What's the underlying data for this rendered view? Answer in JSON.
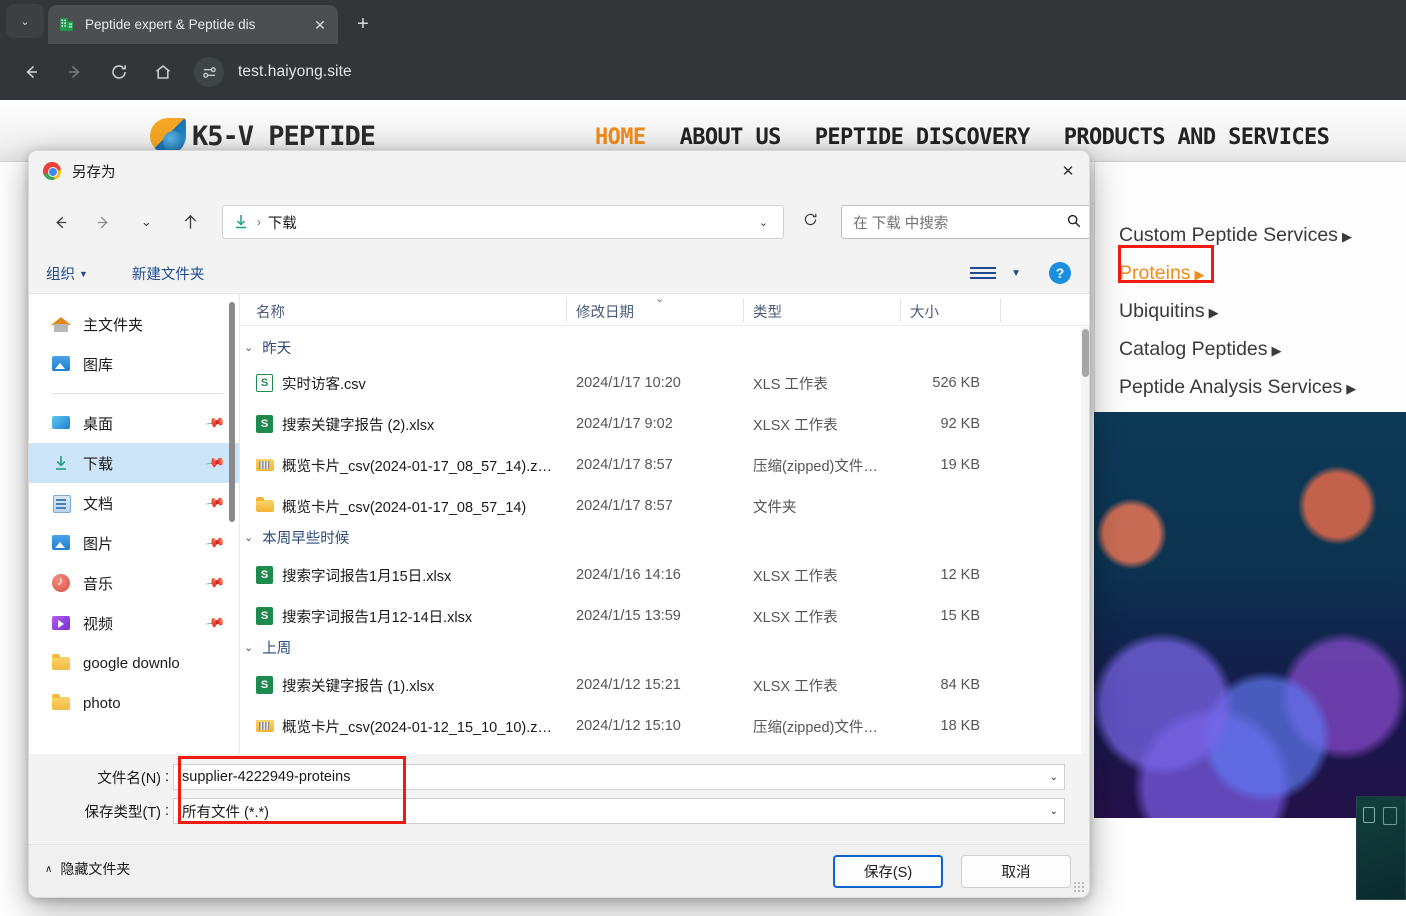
{
  "browser": {
    "tab": {
      "title": "Peptide expert & Peptide dis",
      "favicon": "building-icon",
      "close": "✕"
    },
    "new_tab": "+",
    "tab_list": "⌄",
    "nav": {
      "back": "←",
      "forward": "→",
      "reload": "⟳",
      "home": "⌂"
    },
    "url": "test.haiyong.site"
  },
  "website": {
    "logo_text": "K5-V PEPTIDE",
    "nav": [
      {
        "label": "HOME",
        "active": true
      },
      {
        "label": "ABOUT US",
        "active": false
      },
      {
        "label": "PEPTIDE DISCOVERY",
        "active": false
      },
      {
        "label": "PRODUCTS AND SERVICES",
        "active": false
      }
    ],
    "dropdown": [
      {
        "label": "Custom Peptide Services",
        "caret": "▶",
        "highlight": false
      },
      {
        "label": "Proteins",
        "caret": "▶",
        "highlight": true
      },
      {
        "label": "Ubiquitins",
        "caret": "▶",
        "highlight": false
      },
      {
        "label": "Catalog Peptides",
        "caret": "▶",
        "highlight": false
      },
      {
        "label": "Peptide Analysis Services",
        "caret": "▶",
        "highlight": false
      }
    ],
    "accent_color": "#ef8c1c"
  },
  "dialog": {
    "title": "另存为",
    "close": "✕",
    "nav": {
      "back": "←",
      "forward": "→",
      "recent": "⌄",
      "up": "↑",
      "refresh": "⟳"
    },
    "address": {
      "icon": "download-icon",
      "separator": "›",
      "path": "下载",
      "chevron": "⌄"
    },
    "search": {
      "placeholder": "在 下载 中搜索",
      "icon": "search-icon"
    },
    "commands": {
      "organize": "组织",
      "organize_caret": "▼",
      "new_folder": "新建文件夹",
      "view_caret": "▼",
      "help": "?"
    },
    "sidebar": [
      {
        "label": "主文件夹",
        "icon": "home-icon",
        "pinned": false,
        "selected": false
      },
      {
        "label": "图库",
        "icon": "gallery-icon",
        "pinned": false,
        "selected": false
      },
      {
        "label": "桌面",
        "icon": "desktop-icon",
        "pinned": true,
        "selected": false
      },
      {
        "label": "下载",
        "icon": "download-icon",
        "pinned": true,
        "selected": true
      },
      {
        "label": "文档",
        "icon": "documents-icon",
        "pinned": true,
        "selected": false
      },
      {
        "label": "图片",
        "icon": "pictures-icon",
        "pinned": true,
        "selected": false
      },
      {
        "label": "音乐",
        "icon": "music-icon",
        "pinned": true,
        "selected": false
      },
      {
        "label": "视频",
        "icon": "video-icon",
        "pinned": true,
        "selected": false
      },
      {
        "label": "google downlo",
        "icon": "folder-icon",
        "pinned": false,
        "selected": false
      },
      {
        "label": "photo",
        "icon": "folder-icon",
        "pinned": false,
        "selected": false
      }
    ],
    "columns": [
      "名称",
      "修改日期",
      "类型",
      "大小"
    ],
    "sort_caret": "⌄",
    "groups": [
      {
        "label": "昨天",
        "caret": "⌄",
        "files": [
          {
            "name": "实时访客.csv",
            "date": "2024/1/17 10:20",
            "type": "XLS 工作表",
            "size": "526 KB",
            "icon": "xls-icon"
          },
          {
            "name": "搜索关键字报告 (2).xlsx",
            "date": "2024/1/17 9:02",
            "type": "XLSX 工作表",
            "size": "92 KB",
            "icon": "xlsx-icon"
          },
          {
            "name": "概览卡片_csv(2024-01-17_08_57_14).z…",
            "date": "2024/1/17 8:57",
            "type": "压缩(zipped)文件…",
            "size": "19 KB",
            "icon": "zip-icon"
          },
          {
            "name": "概览卡片_csv(2024-01-17_08_57_14)",
            "date": "2024/1/17 8:57",
            "type": "文件夹",
            "size": "",
            "icon": "folder-icon"
          }
        ]
      },
      {
        "label": "本周早些时候",
        "caret": "⌄",
        "files": [
          {
            "name": "搜索字词报告1月15日.xlsx",
            "date": "2024/1/16 14:16",
            "type": "XLSX 工作表",
            "size": "12 KB",
            "icon": "xlsx-icon"
          },
          {
            "name": "搜索字词报告1月12-14日.xlsx",
            "date": "2024/1/15 13:59",
            "type": "XLSX 工作表",
            "size": "15 KB",
            "icon": "xlsx-icon"
          }
        ]
      },
      {
        "label": "上周",
        "caret": "⌄",
        "files": [
          {
            "name": "搜索关键字报告 (1).xlsx",
            "date": "2024/1/12 15:21",
            "type": "XLSX 工作表",
            "size": "84 KB",
            "icon": "xlsx-icon"
          },
          {
            "name": "概览卡片_csv(2024-01-12_15_10_10).z…",
            "date": "2024/1/12 15:10",
            "type": "压缩(zipped)文件…",
            "size": "18 KB",
            "icon": "zip-icon"
          }
        ]
      }
    ],
    "fields": {
      "filename_label": "文件名(N)",
      "filename_value": "supplier-4222949-proteins",
      "filetype_label": "保存类型(T)",
      "filetype_value": "所有文件 (*.*)",
      "colon": ":",
      "chevron": "⌄"
    },
    "footer": {
      "hide_folders": "隐藏文件夹",
      "hide_caret": "∧",
      "save": "保存(S)",
      "cancel": "取消"
    }
  },
  "annotations": {
    "highlight_color": "#ee1b11"
  }
}
